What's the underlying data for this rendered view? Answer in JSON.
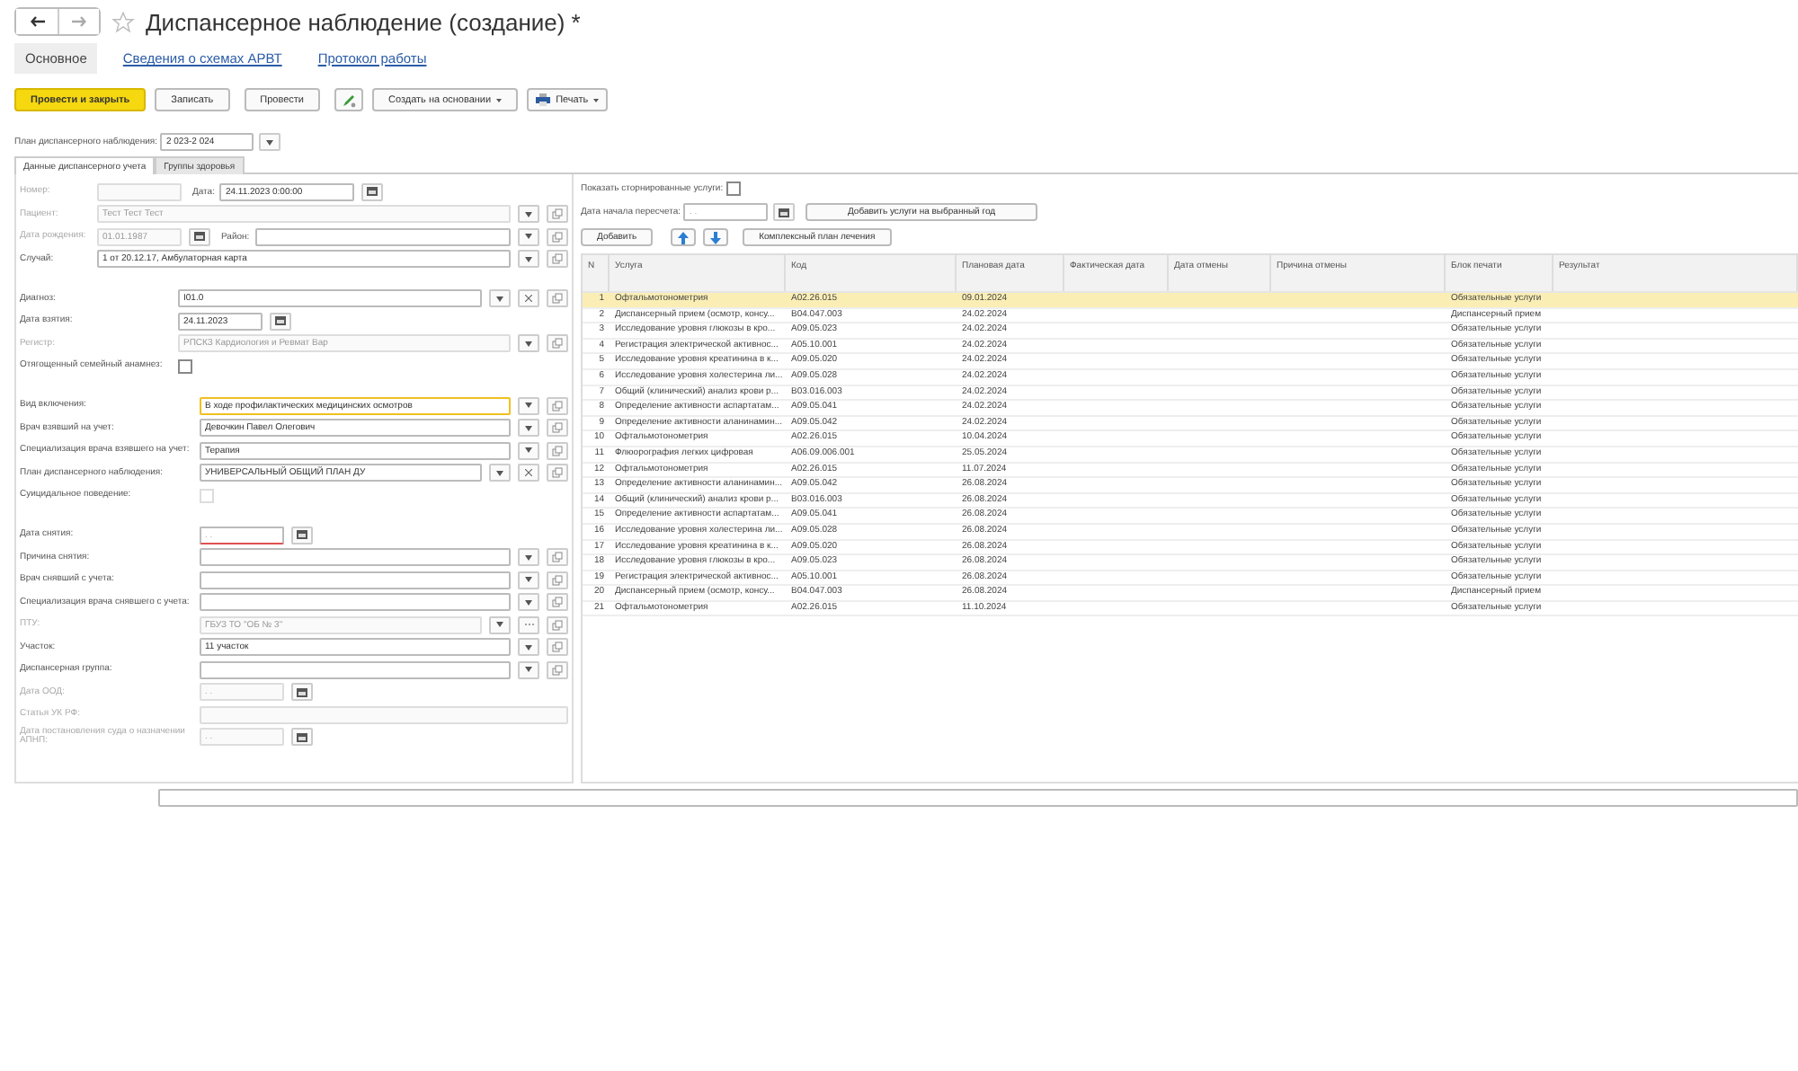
{
  "window": {
    "title": "Диспансерное наблюдение (создание) *",
    "favorite": false
  },
  "nav_tabs": [
    {
      "label": "Основное",
      "selected": true
    },
    {
      "label": "Сведения о схемах АРВТ",
      "selected": false
    },
    {
      "label": "Протокол работы",
      "selected": false
    }
  ],
  "toolbar": [
    {
      "kind": "primary",
      "label": "Провести и закрыть"
    },
    {
      "kind": "plain",
      "label": "Записать"
    },
    {
      "kind": "plain",
      "label": "Провести"
    },
    {
      "kind": "icon"
    },
    {
      "kind": "menu",
      "label": "Создать на основании"
    },
    {
      "kind": "print",
      "label": "Печать"
    }
  ],
  "plan": {
    "label": "План диспансерного наблюдения:",
    "value": "2 023-2 024"
  },
  "form_tabs": [
    {
      "label": "Данные диспансерного учета",
      "selected": true
    },
    {
      "label": "Группы здоровья",
      "selected": false
    }
  ],
  "form_sections": [
    [
      {
        "label": "Номер:",
        "disabled": true,
        "fields": [
          {
            "kind": "short"
          },
          {
            "kind": "date",
            "label": "Дата:",
            "value": "24.11.2023  0:00:00"
          }
        ]
      },
      {
        "label": "Пациент:",
        "disabled": true,
        "fields": [
          {
            "kind": "select",
            "value": "Тест Тест Тест",
            "buttons": [
              {
                "kind": "dropdown"
              },
              {
                "kind": "open"
              }
            ]
          }
        ]
      },
      {
        "label": "Дата рождения:",
        "disabled": true,
        "fields": [
          {
            "kind": "date",
            "value": "01.01.1987"
          },
          {
            "kind": "select",
            "label": "Район:",
            "buttons": [
              {
                "kind": "dropdown"
              },
              {
                "kind": "open"
              }
            ]
          }
        ]
      },
      {
        "label": "Случай:",
        "disabled": false,
        "fields": [
          {
            "kind": "select",
            "value": "1 от 20.12.17, Амбулаторная карта",
            "buttons": [
              {
                "kind": "dropdown"
              },
              {
                "kind": "open"
              }
            ]
          }
        ]
      }
    ],
    [
      {
        "label": "Диагноз:",
        "disabled": false,
        "fields": [
          {
            "kind": "select",
            "value": "I01.0",
            "buttons": [
              {
                "kind": "dropdown"
              },
              {
                "kind": "clear"
              },
              {
                "kind": "open"
              }
            ]
          }
        ]
      },
      {
        "label": "Дата взятия:",
        "disabled": false,
        "fields": [
          {
            "kind": "date",
            "value": "24.11.2023"
          }
        ]
      },
      {
        "label": "Регистр:",
        "disabled": true,
        "fields": [
          {
            "kind": "select",
            "value": "РПСКЗ Кардиология и Ревмат Вар",
            "buttons": [
              {
                "kind": "dropdown"
              },
              {
                "kind": "open"
              }
            ]
          }
        ]
      },
      {
        "label": "Отягощенный семейный анамнез:",
        "disabled": false,
        "fields": [
          {
            "kind": "checkbox",
            "checked": false
          }
        ]
      }
    ],
    [
      {
        "label": "Вид включения:",
        "disabled": false,
        "fields": [
          {
            "kind": "select",
            "value": "В ходе профилактических медицинских осмотров",
            "focused": true,
            "buttons": [
              {
                "kind": "dropdown"
              },
              {
                "kind": "open"
              }
            ]
          }
        ]
      },
      {
        "label": "Врач взявший на учет:",
        "disabled": false,
        "fields": [
          {
            "kind": "select",
            "value": "Девочкин Павел Олегович",
            "buttons": [
              {
                "kind": "dropdown"
              },
              {
                "kind": "open"
              }
            ]
          }
        ]
      },
      {
        "label": "Специализация врача взявшего на учет:",
        "disabled": false,
        "fields": [
          {
            "kind": "select",
            "value": "Терапия",
            "buttons": [
              {
                "kind": "dropdown"
              },
              {
                "kind": "open"
              }
            ]
          }
        ]
      },
      {
        "label": "План диспансерного наблюдения:",
        "disabled": false,
        "fields": [
          {
            "kind": "select",
            "value": "УНИВЕРСАЛЬНЫЙ ОБЩИЙ ПЛАН ДУ",
            "buttons": [
              {
                "kind": "dropdown"
              },
              {
                "kind": "clear"
              },
              {
                "kind": "open"
              }
            ]
          }
        ]
      },
      {
        "label": "Суицидальное поведение:",
        "disabled": false,
        "fields": [
          {
            "kind": "checkbox",
            "checked": false,
            "disabled": true
          }
        ]
      }
    ],
    [
      {
        "label": "Дата снятия:",
        "disabled": false,
        "fields": [
          {
            "kind": "date",
            "placeholder": ". .",
            "invalid": true
          }
        ]
      },
      {
        "label": "Причина снятия:",
        "disabled": false,
        "fields": [
          {
            "kind": "select",
            "buttons": [
              {
                "kind": "dropdown"
              },
              {
                "kind": "open"
              }
            ]
          }
        ]
      },
      {
        "label": "Врач снявший с учета:",
        "disabled": false,
        "fields": [
          {
            "kind": "select",
            "buttons": [
              {
                "kind": "dropdown"
              },
              {
                "kind": "open"
              }
            ]
          }
        ]
      },
      {
        "label": "Специализация врача снявшего с учета:",
        "disabled": false,
        "fields": [
          {
            "kind": "select",
            "buttons": [
              {
                "kind": "dropdown"
              },
              {
                "kind": "open"
              }
            ]
          }
        ]
      },
      {
        "label": "ПТУ:",
        "disabled": true,
        "fields": [
          {
            "kind": "select",
            "value": "ГБУЗ ТО \"ОБ № 3\"",
            "buttons": [
              {
                "kind": "dropdown"
              },
              {
                "kind": "ellipsis"
              },
              {
                "kind": "open"
              }
            ]
          }
        ]
      },
      {
        "label": "Участок:",
        "disabled": false,
        "fields": [
          {
            "kind": "select",
            "value": "11 участок",
            "buttons": [
              {
                "kind": "dropdown"
              },
              {
                "kind": "open"
              }
            ]
          }
        ]
      },
      {
        "label": "Диспансерная группа:",
        "disabled": false,
        "fields": [
          {
            "kind": "select",
            "buttons": [
              {
                "kind": "dropdown"
              },
              {
                "kind": "open"
              }
            ]
          }
        ]
      },
      {
        "label": "Дата ООД:",
        "disabled": true,
        "fields": [
          {
            "kind": "date",
            "placeholder": ". ."
          }
        ]
      },
      {
        "label": "Статья УК РФ:",
        "disabled": true,
        "fields": [
          {
            "kind": "text"
          }
        ]
      },
      {
        "label": "Дата постановления суда о назначении АПНП:",
        "disabled": true,
        "fields": [
          {
            "kind": "date",
            "placeholder": ". ."
          }
        ]
      }
    ]
  ],
  "services_panel": {
    "show_canceled": {
      "label": "Показать сторнированные услуги:",
      "checked": false
    },
    "recalc": {
      "label": "Дата начала пересчета:",
      "placeholder": ". .",
      "button": "Добавить услуги на выбранный год"
    },
    "buttons": [
      {
        "kind": "text",
        "label": "Добавить"
      },
      {
        "kind": "up"
      },
      {
        "kind": "down"
      },
      {
        "kind": "text",
        "label": "Комплексный план лечения"
      }
    ],
    "table": {
      "columns": [
        "N",
        "Услуга",
        "Код",
        "Плановая дата",
        "Фактическая дата",
        "Дата отмены",
        "Причина отмены",
        "Блок печати",
        "Результат"
      ],
      "rows": [
        {
          "n": "1",
          "service": "Офтальмотонометрия",
          "code": "A02.26.015",
          "planned": "09.01.2024",
          "block": "Обязательные услуги",
          "selected": true
        },
        {
          "n": "2",
          "service": "Диспансерный прием (осмотр, консу...",
          "code": "B04.047.003",
          "planned": "24.02.2024",
          "block": "Диспансерный прием",
          "selected": false
        },
        {
          "n": "3",
          "service": "Исследование уровня глюкозы в кро...",
          "code": "A09.05.023",
          "planned": "24.02.2024",
          "block": "Обязательные услуги",
          "selected": false
        },
        {
          "n": "4",
          "service": "Регистрация электрической активнос...",
          "code": "A05.10.001",
          "planned": "24.02.2024",
          "block": "Обязательные услуги",
          "selected": false
        },
        {
          "n": "5",
          "service": "Исследование уровня креатинина в к...",
          "code": "A09.05.020",
          "planned": "24.02.2024",
          "block": "Обязательные услуги",
          "selected": false
        },
        {
          "n": "6",
          "service": "Исследование уровня холестерина ли...",
          "code": "A09.05.028",
          "planned": "24.02.2024",
          "block": "Обязательные услуги",
          "selected": false
        },
        {
          "n": "7",
          "service": "Общий (клинический) анализ крови р...",
          "code": "B03.016.003",
          "planned": "24.02.2024",
          "block": "Обязательные услуги",
          "selected": false
        },
        {
          "n": "8",
          "service": "Определение активности аспартатам...",
          "code": "A09.05.041",
          "planned": "24.02.2024",
          "block": "Обязательные услуги",
          "selected": false
        },
        {
          "n": "9",
          "service": "Определение активности аланинамин...",
          "code": "A09.05.042",
          "planned": "24.02.2024",
          "block": "Обязательные услуги",
          "selected": false
        },
        {
          "n": "10",
          "service": "Офтальмотонометрия",
          "code": "A02.26.015",
          "planned": "10.04.2024",
          "block": "Обязательные услуги",
          "selected": false
        },
        {
          "n": "11",
          "service": "Флюорография легких цифровая",
          "code": "A06.09.006.001",
          "planned": "25.05.2024",
          "block": "Обязательные услуги",
          "selected": false
        },
        {
          "n": "12",
          "service": "Офтальмотонометрия",
          "code": "A02.26.015",
          "planned": "11.07.2024",
          "block": "Обязательные услуги",
          "selected": false
        },
        {
          "n": "13",
          "service": "Определение активности аланинамин...",
          "code": "A09.05.042",
          "planned": "26.08.2024",
          "block": "Обязательные услуги",
          "selected": false
        },
        {
          "n": "14",
          "service": "Общий (клинический) анализ крови р...",
          "code": "B03.016.003",
          "planned": "26.08.2024",
          "block": "Обязательные услуги",
          "selected": false
        },
        {
          "n": "15",
          "service": "Определение активности аспартатам...",
          "code": "A09.05.041",
          "planned": "26.08.2024",
          "block": "Обязательные услуги",
          "selected": false
        },
        {
          "n": "16",
          "service": "Исследование уровня холестерина ли...",
          "code": "A09.05.028",
          "planned": "26.08.2024",
          "block": "Обязательные услуги",
          "selected": false
        },
        {
          "n": "17",
          "service": "Исследование уровня креатинина в к...",
          "code": "A09.05.020",
          "planned": "26.08.2024",
          "block": "Обязательные услуги",
          "selected": false
        },
        {
          "n": "18",
          "service": "Исследование уровня глюкозы в кро...",
          "code": "A09.05.023",
          "planned": "26.08.2024",
          "block": "Обязательные услуги",
          "selected": false
        },
        {
          "n": "19",
          "service": "Регистрация электрической активнос...",
          "code": "A05.10.001",
          "planned": "26.08.2024",
          "block": "Обязательные услуги",
          "selected": false
        },
        {
          "n": "20",
          "service": "Диспансерный прием (осмотр, консу...",
          "code": "B04.047.003",
          "planned": "26.08.2024",
          "block": "Диспансерный прием",
          "selected": false
        },
        {
          "n": "21",
          "service": "Офтальмотонометрия",
          "code": "A02.26.015",
          "planned": "11.10.2024",
          "block": "Обязательные услуги",
          "selected": false
        }
      ]
    }
  },
  "comment": {
    "kind": "text"
  }
}
